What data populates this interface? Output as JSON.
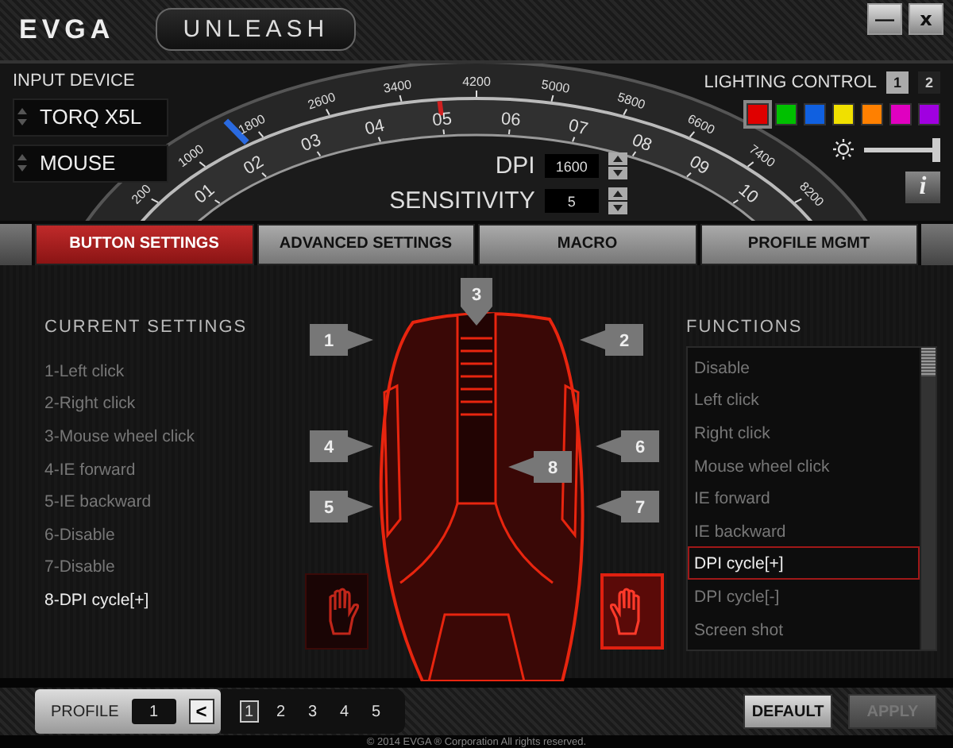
{
  "title_bar": {
    "logo": "EVGA",
    "product": "UNLEASH",
    "buttons": [
      {
        "kind": "minimize",
        "label": "—"
      },
      {
        "kind": "close",
        "label": "x"
      }
    ]
  },
  "input_device": {
    "label": "INPUT DEVICE",
    "fields": [
      "TORQ X5L",
      "MOUSE"
    ]
  },
  "dial": {
    "dpi_scale": {
      "ticks": [
        "200",
        "1000",
        "1800",
        "2600",
        "3400",
        "4200",
        "5000",
        "5800",
        "6600",
        "7400",
        "8200"
      ],
      "level": 0.175
    },
    "sensitivity_scale": {
      "ticks": [
        "01",
        "02",
        "03",
        "04",
        "05",
        "06",
        "07",
        "08",
        "09",
        "10"
      ],
      "level": 0.444
    }
  },
  "dpi": {
    "label": "DPI",
    "value": "1600"
  },
  "sensitivity": {
    "label": "SENSITIVITY",
    "value": "5"
  },
  "lighting_control": {
    "label": "LIGHTING CONTROL",
    "modes": [
      {
        "label": "1",
        "selected": true
      },
      {
        "label": "2",
        "selected": false
      }
    ],
    "colors": [
      {
        "color": "#e00000",
        "selected": true
      },
      {
        "color": "#00c000",
        "selected": false
      },
      {
        "color": "#1060e0",
        "selected": false
      },
      {
        "color": "#f0e000",
        "selected": false
      },
      {
        "color": "#ff8000",
        "selected": false
      },
      {
        "color": "#e000c0",
        "selected": false
      },
      {
        "color": "#a000e0",
        "selected": false
      }
    ],
    "brightness": {
      "level": 1.0
    },
    "info_button": "i"
  },
  "tabs": [
    {
      "label": "BUTTON SETTINGS",
      "selected": true
    },
    {
      "label": "ADVANCED SETTINGS",
      "selected": false
    },
    {
      "label": "MACRO",
      "selected": false
    },
    {
      "label": "PROFILE MGMT",
      "selected": false
    }
  ],
  "current_settings": {
    "title": "CURRENT SETTINGS",
    "items": [
      {
        "label": "1-Left click",
        "selected": false
      },
      {
        "label": "2-Right click",
        "selected": false
      },
      {
        "label": "3-Mouse wheel click",
        "selected": false
      },
      {
        "label": "4-IE forward",
        "selected": false
      },
      {
        "label": "5-IE backward",
        "selected": false
      },
      {
        "label": "6-Disable",
        "selected": false
      },
      {
        "label": "7-Disable",
        "selected": false
      },
      {
        "label": "8-DPI cycle[+]",
        "selected": true
      }
    ]
  },
  "mouse_callouts": [
    {
      "label": "1",
      "kind": "right"
    },
    {
      "label": "2",
      "kind": "left"
    },
    {
      "label": "3",
      "kind": "down"
    },
    {
      "label": "4",
      "kind": "right"
    },
    {
      "label": "5",
      "kind": "right"
    },
    {
      "label": "6",
      "kind": "left"
    },
    {
      "label": "7",
      "kind": "left"
    },
    {
      "label": "8",
      "kind": "left"
    }
  ],
  "hand_buttons": [
    {
      "kind": "left",
      "selected": false
    },
    {
      "kind": "right",
      "selected": true
    }
  ],
  "functions": {
    "title": "FUNCTIONS",
    "items": [
      {
        "label": "Disable",
        "selected": false
      },
      {
        "label": "Left click",
        "selected": false
      },
      {
        "label": "Right click",
        "selected": false
      },
      {
        "label": "Mouse wheel click",
        "selected": false
      },
      {
        "label": "IE forward",
        "selected": false
      },
      {
        "label": "IE backward",
        "selected": false
      },
      {
        "label": "DPI cycle[+]",
        "selected": true
      },
      {
        "label": "DPI cycle[-]",
        "selected": false
      },
      {
        "label": "Screen shot",
        "selected": false
      }
    ]
  },
  "footer": {
    "profile_label": "PROFILE",
    "profile_value": "1",
    "back_button": "<",
    "profiles": [
      {
        "label": "1",
        "selected": true
      },
      {
        "label": "2",
        "selected": false
      },
      {
        "label": "3",
        "selected": false
      },
      {
        "label": "4",
        "selected": false
      },
      {
        "label": "5",
        "selected": false
      }
    ],
    "buttons": [
      {
        "label": "DEFAULT",
        "disabled": false
      },
      {
        "label": "APPLY",
        "disabled": true
      }
    ],
    "copyright": "© 2014 EVGA ® Corporation All rights reserved."
  }
}
